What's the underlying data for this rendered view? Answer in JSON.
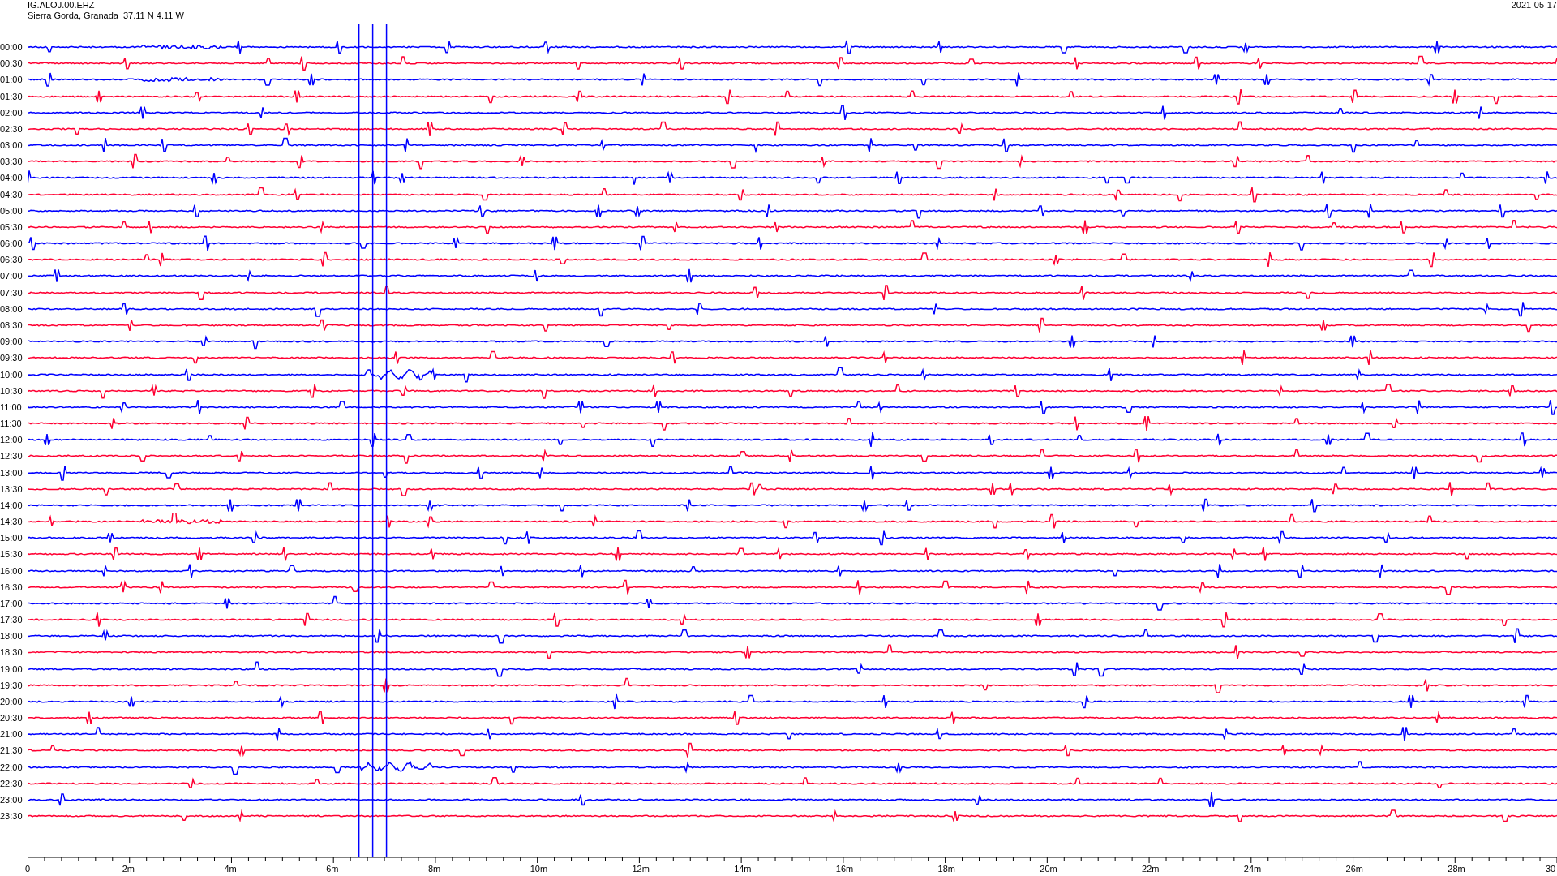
{
  "header": {
    "station": "IG.ALOJ.00.EHZ",
    "location": "Sierra Gorda, Granada  37.11 N 4.11 W",
    "date": "2021-05-17"
  },
  "rows": [
    {
      "label": "00:00",
      "color": "#0000ff"
    },
    {
      "label": "00:30",
      "color": "#ff0033"
    },
    {
      "label": "01:00",
      "color": "#0000ff"
    },
    {
      "label": "01:30",
      "color": "#ff0033"
    },
    {
      "label": "02:00",
      "color": "#0000ff"
    },
    {
      "label": "02:30",
      "color": "#ff0033"
    },
    {
      "label": "03:00",
      "color": "#0000ff"
    },
    {
      "label": "03:30",
      "color": "#ff0033"
    },
    {
      "label": "04:00",
      "color": "#0000ff"
    },
    {
      "label": "04:30",
      "color": "#ff0033"
    },
    {
      "label": "05:00",
      "color": "#0000ff"
    },
    {
      "label": "05:30",
      "color": "#ff0033"
    },
    {
      "label": "06:00",
      "color": "#0000ff"
    },
    {
      "label": "06:30",
      "color": "#ff0033"
    },
    {
      "label": "07:00",
      "color": "#0000ff"
    },
    {
      "label": "07:30",
      "color": "#ff0033"
    },
    {
      "label": "08:00",
      "color": "#0000ff"
    },
    {
      "label": "08:30",
      "color": "#ff0033"
    },
    {
      "label": "09:00",
      "color": "#0000ff"
    },
    {
      "label": "09:30",
      "color": "#ff0033"
    },
    {
      "label": "10:00",
      "color": "#0000ff"
    },
    {
      "label": "10:30",
      "color": "#ff0033"
    },
    {
      "label": "11:00",
      "color": "#0000ff"
    },
    {
      "label": "11:30",
      "color": "#ff0033"
    },
    {
      "label": "12:00",
      "color": "#0000ff"
    },
    {
      "label": "12:30",
      "color": "#ff0033"
    },
    {
      "label": "13:00",
      "color": "#0000ff"
    },
    {
      "label": "13:30",
      "color": "#ff0033"
    },
    {
      "label": "14:00",
      "color": "#0000ff"
    },
    {
      "label": "14:30",
      "color": "#ff0033"
    },
    {
      "label": "15:00",
      "color": "#0000ff"
    },
    {
      "label": "15:30",
      "color": "#ff0033"
    },
    {
      "label": "16:00",
      "color": "#0000ff"
    },
    {
      "label": "16:30",
      "color": "#ff0033"
    },
    {
      "label": "17:00",
      "color": "#0000ff"
    },
    {
      "label": "17:30",
      "color": "#ff0033"
    },
    {
      "label": "18:00",
      "color": "#0000ff"
    },
    {
      "label": "18:30",
      "color": "#ff0033"
    },
    {
      "label": "19:00",
      "color": "#0000ff"
    },
    {
      "label": "19:30",
      "color": "#ff0033"
    },
    {
      "label": "20:00",
      "color": "#0000ff"
    },
    {
      "label": "20:30",
      "color": "#ff0033"
    },
    {
      "label": "21:00",
      "color": "#0000ff"
    },
    {
      "label": "21:30",
      "color": "#ff0033"
    },
    {
      "label": "22:00",
      "color": "#0000ff"
    },
    {
      "label": "22:30",
      "color": "#ff0033"
    },
    {
      "label": "23:00",
      "color": "#0000ff"
    },
    {
      "label": "23:30",
      "color": "#ff0033"
    }
  ],
  "axis": {
    "ticks": [
      "0",
      "2m",
      "4m",
      "6m",
      "8m",
      "10m",
      "12m",
      "14m",
      "16m",
      "18m",
      "20m",
      "22m",
      "24m",
      "26m",
      "28m",
      "30"
    ]
  }
}
